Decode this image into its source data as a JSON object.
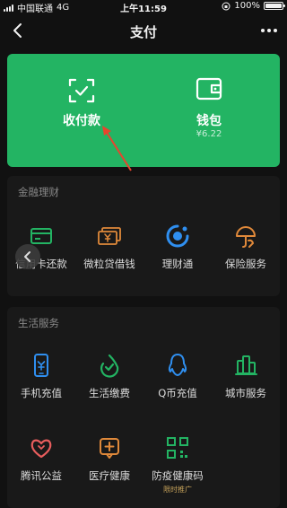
{
  "status_bar": {
    "carrier": "中国联通",
    "network": "4G",
    "time": "上午11:59",
    "battery": "100%",
    "battery_level": 1.0
  },
  "nav": {
    "title": "支付",
    "back_icon": "chevron-left-icon",
    "more_icon": "more-dots-icon"
  },
  "pay_card": {
    "color": "#23b463",
    "items": [
      {
        "label": "收付款",
        "icon": "scan-check-icon"
      },
      {
        "label": "钱包",
        "sub": "¥6.22",
        "icon": "wallet-icon"
      }
    ]
  },
  "finance": {
    "title": "金融理财",
    "items": [
      {
        "label": "信用卡还款",
        "icon": "credit-card-icon"
      },
      {
        "label": "微粒贷借钱",
        "icon": "yen-bills-icon"
      },
      {
        "label": "理财通",
        "icon": "wealth-circle-icon"
      },
      {
        "label": "保险服务",
        "icon": "umbrella-hand-icon"
      }
    ]
  },
  "life": {
    "title": "生活服务",
    "items": [
      {
        "label": "手机充值",
        "icon": "phone-icon"
      },
      {
        "label": "生活缴费",
        "icon": "leaf-check-icon"
      },
      {
        "label": "Q币充值",
        "icon": "penguin-icon"
      },
      {
        "label": "城市服务",
        "icon": "city-buildings-icon"
      },
      {
        "label": "腾讯公益",
        "icon": "heart-icon"
      },
      {
        "label": "医疗健康",
        "icon": "medical-plus-icon"
      },
      {
        "label": "防疫健康码",
        "icon": "qr-code-icon",
        "promo": "限时推广"
      }
    ]
  },
  "colors": {
    "background": "#111111",
    "section": "#191919",
    "accent_green": "#23b463",
    "icon_orange": "#e0893a",
    "icon_blue": "#2f8ff0",
    "icon_red": "#e85d5d",
    "annotation_arrow": "#e8442e"
  }
}
